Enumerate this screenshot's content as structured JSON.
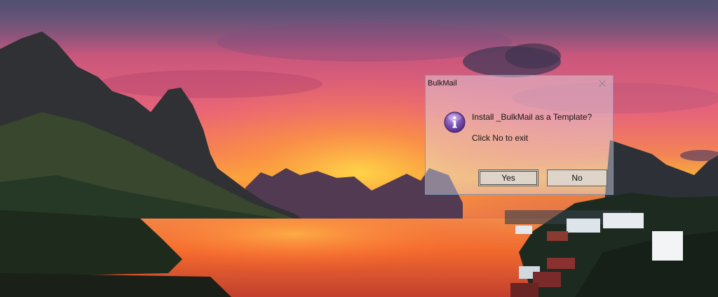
{
  "dialog": {
    "title": "BulkMail",
    "message": "Install _BulkMail as a Template?",
    "sub_message": "Click No to exit",
    "buttons": {
      "yes": "Yes",
      "no": "No"
    },
    "icon": "info-icon",
    "close_icon": "close-icon"
  },
  "wallpaper": {
    "icon": "wallpaper-image"
  }
}
